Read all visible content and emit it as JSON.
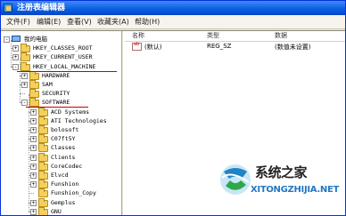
{
  "window": {
    "title": "注册表编辑器"
  },
  "menu": [
    "文件(F)",
    "编辑(E)",
    "查看(V)",
    "收藏夹(A)",
    "帮助(H)"
  ],
  "tree": [
    {
      "label": "我的电脑",
      "level": 0,
      "expander": "-",
      "icon": "computer-icon"
    },
    {
      "label": "HKEY_CLASSES_ROOT",
      "level": 1,
      "expander": "+"
    },
    {
      "label": "HKEY_CURRENT_USER",
      "level": 1,
      "expander": "+"
    },
    {
      "label": "HKEY_LOCAL_MACHINE",
      "level": 1,
      "expander": "-"
    },
    {
      "label": "HARDWARE",
      "level": 2,
      "expander": "+"
    },
    {
      "label": "SAM",
      "level": 2,
      "expander": "+"
    },
    {
      "label": "SECURITY",
      "level": 2,
      "expander": ""
    },
    {
      "label": "SOFTWARE",
      "level": 2,
      "expander": "-"
    },
    {
      "label": "ACD Systems",
      "level": 3,
      "expander": "+"
    },
    {
      "label": "ATI Technologies",
      "level": 3,
      "expander": "+"
    },
    {
      "label": "bolosoft",
      "level": 3,
      "expander": "+"
    },
    {
      "label": "C07ft5Y",
      "level": 3,
      "expander": "+"
    },
    {
      "label": "Classes",
      "level": 3,
      "expander": "+"
    },
    {
      "label": "Clients",
      "level": 3,
      "expander": "+"
    },
    {
      "label": "CoreCodec",
      "level": 3,
      "expander": "+"
    },
    {
      "label": "Elvcd",
      "level": 3,
      "expander": "+"
    },
    {
      "label": "Funshion",
      "level": 3,
      "expander": "+"
    },
    {
      "label": "Funshion_Copy",
      "level": 3,
      "expander": ""
    },
    {
      "label": "Gemplus",
      "level": 3,
      "expander": "+"
    },
    {
      "label": "GNU",
      "level": 3,
      "expander": "+"
    }
  ],
  "columns": {
    "name": "名称",
    "type": "类型",
    "data": "数据"
  },
  "values": [
    {
      "name": "(默认)",
      "type": "REG_SZ",
      "data": "(数值未设置)"
    }
  ],
  "watermark": {
    "text": "系统之家",
    "url": "XITONGZHIJIA.NET"
  },
  "colors": {
    "title_bar": "#0a5ce2",
    "folder": "#f3d05e",
    "highlight_line": "#c40000",
    "watermark_url": "#2378c3"
  }
}
